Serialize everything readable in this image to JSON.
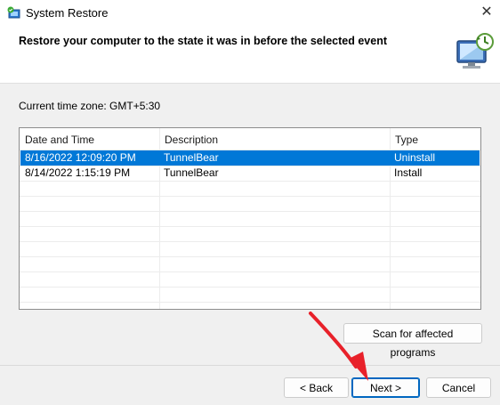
{
  "window": {
    "title": "System Restore",
    "close_icon": "close-icon"
  },
  "header": {
    "text": "Restore your computer to the state it was in before the selected event",
    "icon": "system-restore-monitor-icon"
  },
  "content": {
    "timezone": "Current time zone: GMT+5:30",
    "columns": [
      "Date and Time",
      "Description",
      "Type"
    ],
    "rows": [
      {
        "date": "8/16/2022 12:09:20 PM",
        "description": "TunnelBear",
        "type": "Uninstall",
        "selected": true
      },
      {
        "date": "8/14/2022 1:15:19 PM",
        "description": "TunnelBear",
        "type": "Install",
        "selected": false
      }
    ],
    "scan_label": "Scan for affected programs"
  },
  "footer": {
    "back_label": "< Back",
    "next_label": "Next >",
    "cancel_label": "Cancel"
  },
  "colors": {
    "selection": "#0078d7",
    "annotation_arrow": "#e8212a"
  }
}
